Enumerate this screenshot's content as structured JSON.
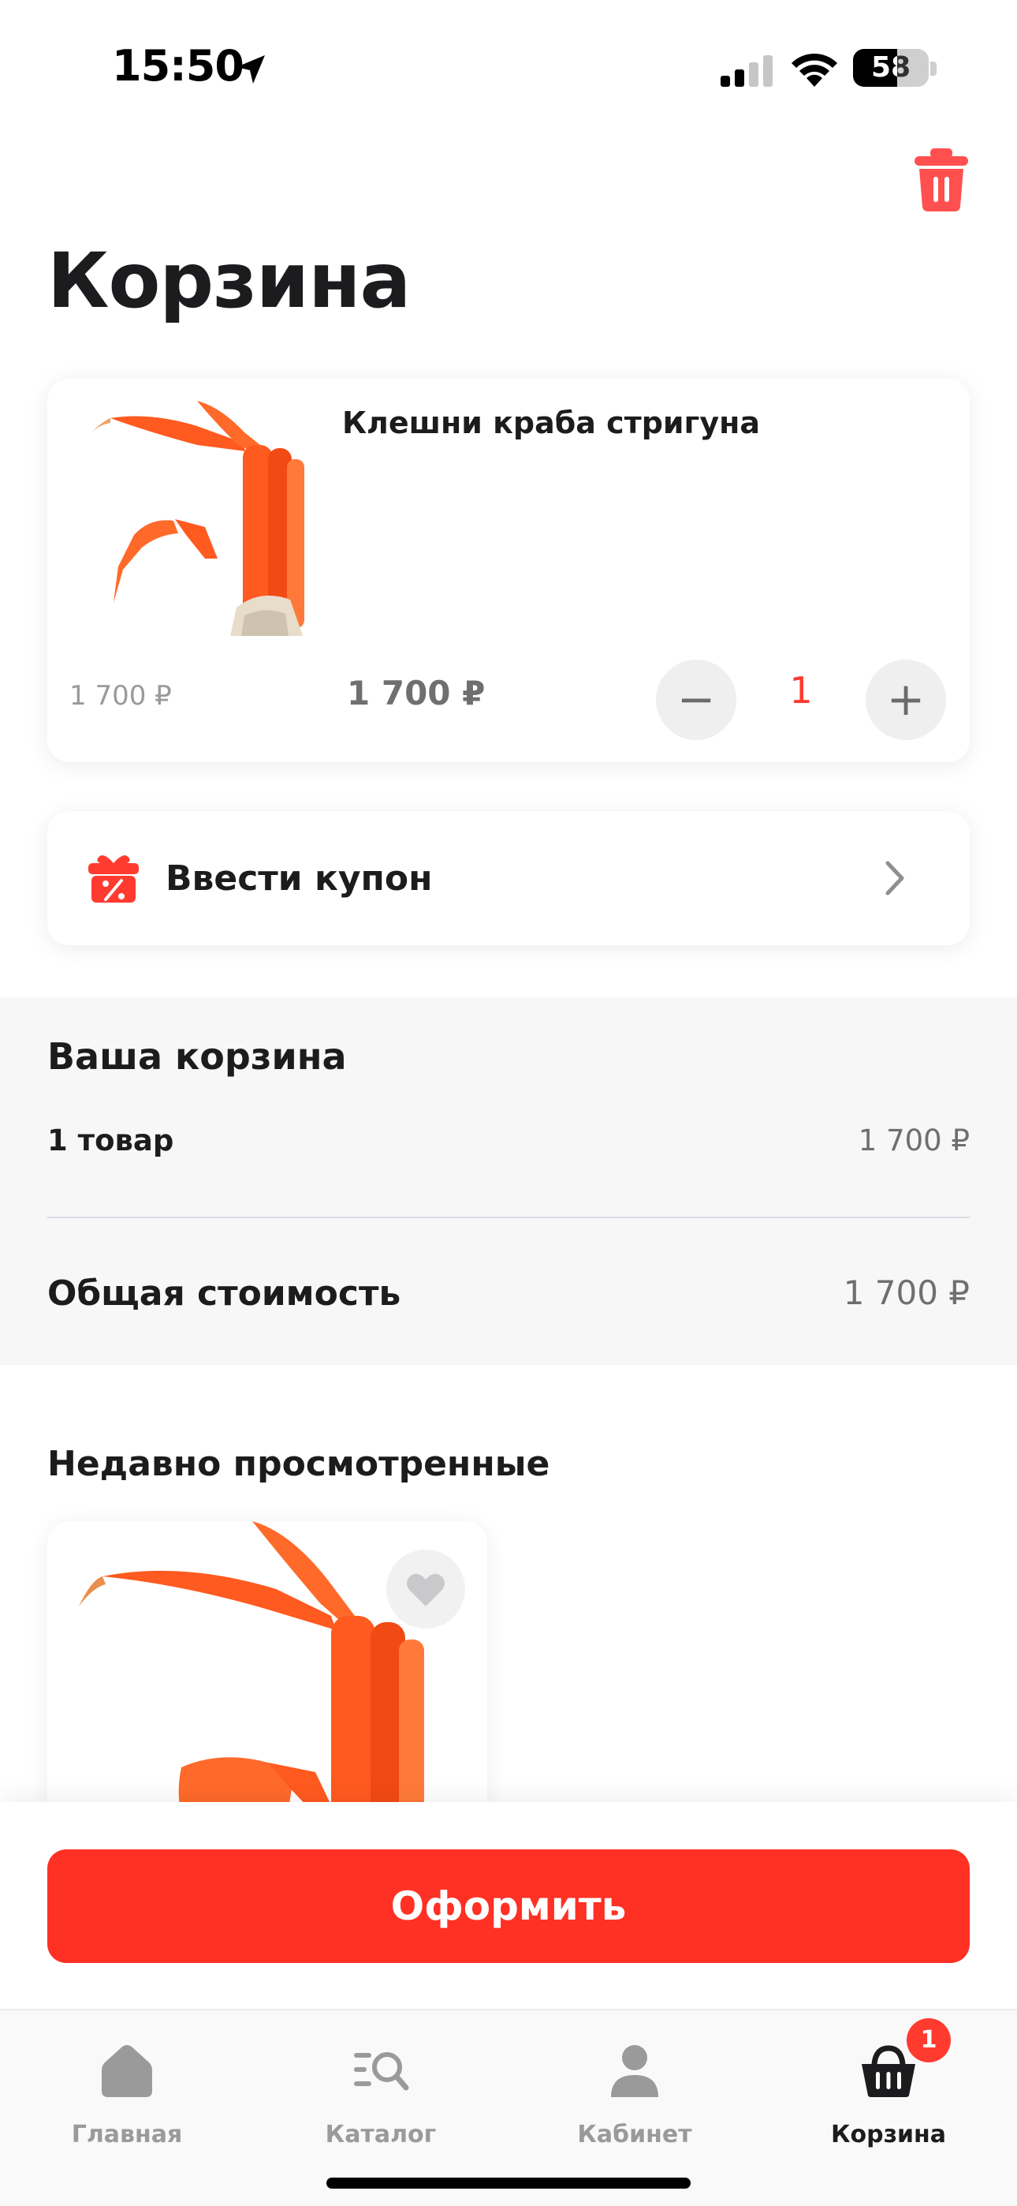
{
  "status_bar": {
    "time": "15:50",
    "battery": "58",
    "battery_level": 0.58
  },
  "header": {
    "title": "Корзина",
    "trash_icon": "trash-icon"
  },
  "cart_item": {
    "name": "Клешни краба стригуна",
    "old_price": "1 700 ₽",
    "price": "1 700 ₽",
    "quantity": "1",
    "minus_label": "−",
    "plus_label": "+",
    "image": "crab-claws-image"
  },
  "coupon": {
    "label": "Ввести купон",
    "icon": "gift-percent-icon"
  },
  "summary": {
    "title": "Ваша корзина",
    "items_count": "1 товар",
    "items_price": "1 700 ₽",
    "total_label": "Общая стоимость",
    "total_price": "1 700 ₽"
  },
  "recent": {
    "title": "Недавно просмотренные"
  },
  "checkout": {
    "label": "Оформить"
  },
  "tabs": [
    {
      "label": "Главная",
      "icon": "home-icon",
      "active": false
    },
    {
      "label": "Каталог",
      "icon": "catalog-search-icon",
      "active": false
    },
    {
      "label": "Кабинет",
      "icon": "user-icon",
      "active": false
    },
    {
      "label": "Корзина",
      "icon": "basket-icon",
      "active": true,
      "badge": "1"
    }
  ],
  "colors": {
    "accent": "#ff3024",
    "quantity": "#ff3b30",
    "crab": "#ff5a1f"
  }
}
